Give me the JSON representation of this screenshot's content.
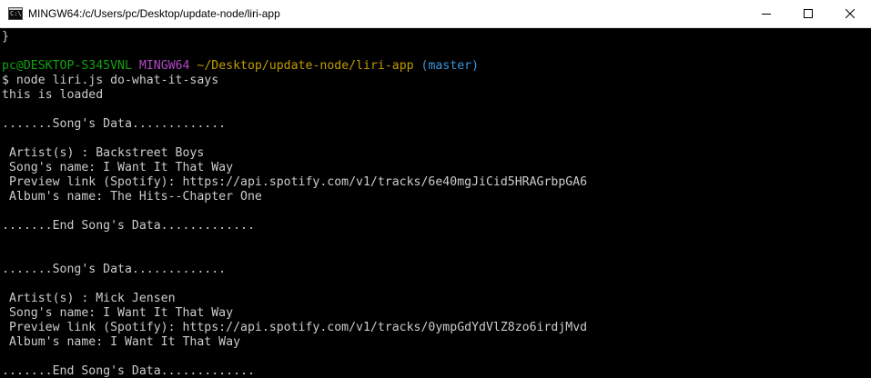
{
  "window": {
    "title": "MINGW64:/c/Users/pc/Desktop/update-node/liri-app",
    "icon": "console-icon",
    "icon_glyph": "C:\\"
  },
  "controls": {
    "minimize_icon": "minimize-icon",
    "maximize_icon": "maximize-icon",
    "close_icon": "close-icon"
  },
  "terminal": {
    "colors": {
      "background": "#000000",
      "text": "#cccccc",
      "user_host": "#13a10e",
      "msystem": "#b148c6",
      "path": "#c19c00",
      "branch": "#3a96dd"
    },
    "lines": [
      {
        "text": "}"
      },
      {
        "text": ""
      },
      {
        "prompt": true,
        "user": "pc@DESKTOP-S345VNL",
        "msystem": "MINGW64",
        "path": "~/Desktop/update-node/liri-app",
        "branch": "(master)"
      },
      {
        "text": "$ node liri.js do-what-it-says"
      },
      {
        "text": "this is loaded"
      },
      {
        "text": ""
      },
      {
        "text": ".......Song's Data............."
      },
      {
        "text": ""
      },
      {
        "text": " Artist(s) : Backstreet Boys"
      },
      {
        "text": " Song's name: I Want It That Way"
      },
      {
        "text": " Preview link (Spotify): https://api.spotify.com/v1/tracks/6e40mgJiCid5HRAGrbpGA6"
      },
      {
        "text": " Album's name: The Hits--Chapter One"
      },
      {
        "text": ""
      },
      {
        "text": ".......End Song's Data............."
      },
      {
        "text": ""
      },
      {
        "text": ""
      },
      {
        "text": ".......Song's Data............."
      },
      {
        "text": ""
      },
      {
        "text": " Artist(s) : Mick Jensen"
      },
      {
        "text": " Song's name: I Want It That Way"
      },
      {
        "text": " Preview link (Spotify): https://api.spotify.com/v1/tracks/0ympGdYdVlZ8zo6irdjMvd"
      },
      {
        "text": " Album's name: I Want It That Way"
      },
      {
        "text": ""
      },
      {
        "text": ".......End Song's Data............."
      }
    ]
  }
}
